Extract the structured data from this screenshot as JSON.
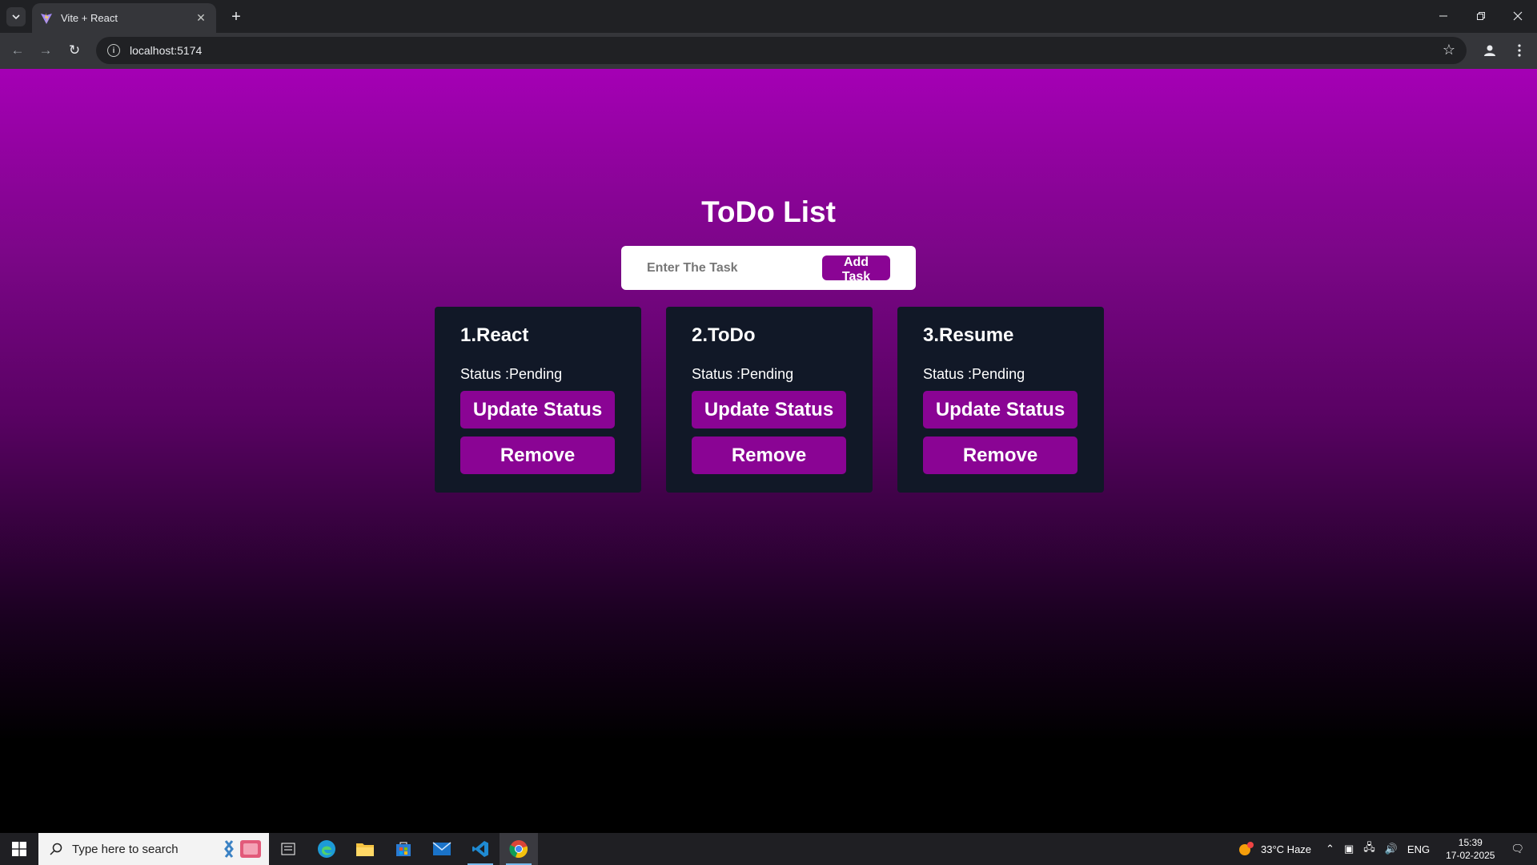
{
  "browser": {
    "tab_title": "Vite + React",
    "url": "localhost:5174"
  },
  "app": {
    "title": "ToDo List",
    "input_placeholder": "Enter The Task",
    "input_value": "",
    "add_button": "Add Task",
    "tasks": [
      {
        "title": "1.React",
        "status": "Status :Pending",
        "update_label": "Update Status",
        "remove_label": "Remove"
      },
      {
        "title": "2.ToDo",
        "status": "Status :Pending",
        "update_label": "Update Status",
        "remove_label": "Remove"
      },
      {
        "title": "3.Resume",
        "status": "Status :Pending",
        "update_label": "Update Status",
        "remove_label": "Remove"
      }
    ]
  },
  "taskbar": {
    "search_placeholder": "Type here to search",
    "weather": "33°C  Haze",
    "language": "ENG",
    "time": "15:39",
    "date": "17-02-2025"
  },
  "colors": {
    "accent": "#8a0494",
    "card_bg": "#111827",
    "gradient_top": "#a500b5"
  }
}
